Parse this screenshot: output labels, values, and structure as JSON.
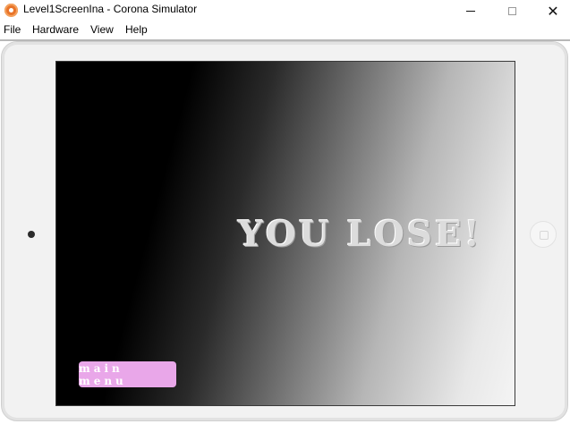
{
  "window": {
    "title": "Level1ScreenIna - Corona Simulator",
    "close_glyph": "✕"
  },
  "menu": {
    "items": [
      "File",
      "Hardware",
      "View",
      "Help"
    ]
  },
  "game": {
    "message": "YOU LOSE!",
    "main_menu_label": "main menu"
  },
  "colors": {
    "main_menu_button": "#e9a7e9",
    "app_icon": "#e8742a",
    "message_text": "#dcdcdc"
  },
  "icons": [
    "corona-app-icon",
    "minimize-icon",
    "maximize-icon",
    "close-icon",
    "front-camera-icon",
    "home-button-icon"
  ]
}
